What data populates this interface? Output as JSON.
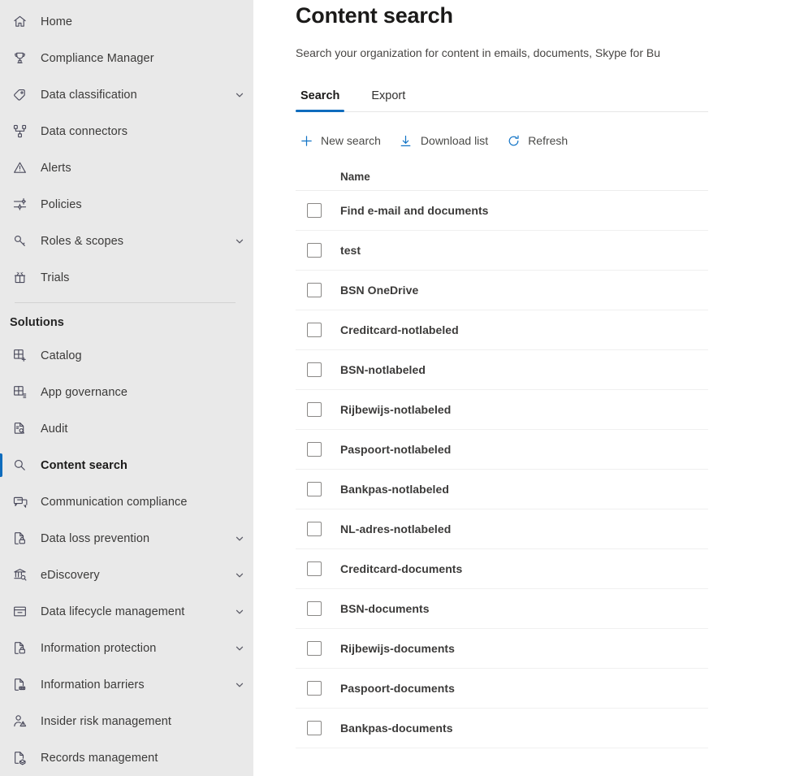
{
  "sidebar": {
    "top_items": [
      {
        "label": "Home",
        "icon": "home-icon",
        "expandable": false
      },
      {
        "label": "Compliance Manager",
        "icon": "trophy-icon",
        "expandable": false
      },
      {
        "label": "Data classification",
        "icon": "tag-icon",
        "expandable": true
      },
      {
        "label": "Data connectors",
        "icon": "connectors-icon",
        "expandable": false
      },
      {
        "label": "Alerts",
        "icon": "warning-triangle-icon",
        "expandable": false
      },
      {
        "label": "Policies",
        "icon": "sliders-icon",
        "expandable": false
      },
      {
        "label": "Roles & scopes",
        "icon": "key-icon",
        "expandable": true
      },
      {
        "label": "Trials",
        "icon": "gift-icon",
        "expandable": false
      }
    ],
    "group_label": "Solutions",
    "solution_items": [
      {
        "label": "Catalog",
        "icon": "grid-plus-icon",
        "expandable": false,
        "selected": false
      },
      {
        "label": "App governance",
        "icon": "grid-list-icon",
        "expandable": false,
        "selected": false
      },
      {
        "label": "Audit",
        "icon": "document-search-icon",
        "expandable": false,
        "selected": false
      },
      {
        "label": "Content search",
        "icon": "search-icon",
        "expandable": false,
        "selected": true
      },
      {
        "label": "Communication compliance",
        "icon": "chat-icon",
        "expandable": false,
        "selected": false
      },
      {
        "label": "Data loss prevention",
        "icon": "document-lock-icon",
        "expandable": true,
        "selected": false
      },
      {
        "label": "eDiscovery",
        "icon": "bank-search-icon",
        "expandable": true,
        "selected": false
      },
      {
        "label": "Data lifecycle management",
        "icon": "archive-icon",
        "expandable": true,
        "selected": false
      },
      {
        "label": "Information protection",
        "icon": "document-lock-icon",
        "expandable": true,
        "selected": false
      },
      {
        "label": "Information barriers",
        "icon": "document-barrier-icon",
        "expandable": true,
        "selected": false
      },
      {
        "label": "Insider risk management",
        "icon": "person-warning-icon",
        "expandable": false,
        "selected": false
      },
      {
        "label": "Records management",
        "icon": "records-icon",
        "expandable": false,
        "selected": false
      }
    ]
  },
  "header": {
    "title": "Content search",
    "subtitle": "Search your organization for content in emails, documents, Skype for Bu"
  },
  "tabs": [
    {
      "label": "Search",
      "active": true
    },
    {
      "label": "Export",
      "active": false
    }
  ],
  "toolbar": [
    {
      "label": "New search",
      "icon": "plus-icon"
    },
    {
      "label": "Download list",
      "icon": "download-icon"
    },
    {
      "label": "Refresh",
      "icon": "refresh-icon"
    }
  ],
  "table": {
    "columns": [
      "Name"
    ],
    "rows": [
      {
        "name": "Find e-mail and documents",
        "checked": false
      },
      {
        "name": "test",
        "checked": false
      },
      {
        "name": "BSN OneDrive",
        "checked": false
      },
      {
        "name": "Creditcard-notlabeled",
        "checked": false
      },
      {
        "name": "BSN-notlabeled",
        "checked": false
      },
      {
        "name": "Rijbewijs-notlabeled",
        "checked": false
      },
      {
        "name": "Paspoort-notlabeled",
        "checked": false
      },
      {
        "name": "Bankpas-notlabeled",
        "checked": false
      },
      {
        "name": "NL-adres-notlabeled",
        "checked": false
      },
      {
        "name": "Creditcard-documents",
        "checked": false
      },
      {
        "name": "BSN-documents",
        "checked": false
      },
      {
        "name": "Rijbewijs-documents",
        "checked": false
      },
      {
        "name": "Paspoort-documents",
        "checked": false
      },
      {
        "name": "Bankpas-documents",
        "checked": false
      }
    ]
  },
  "colors": {
    "accent": "#0f6cbd",
    "toolbar_icon": "#1274c6",
    "sidebar_bg": "#e9e9e9",
    "text": "#3b3a39"
  }
}
